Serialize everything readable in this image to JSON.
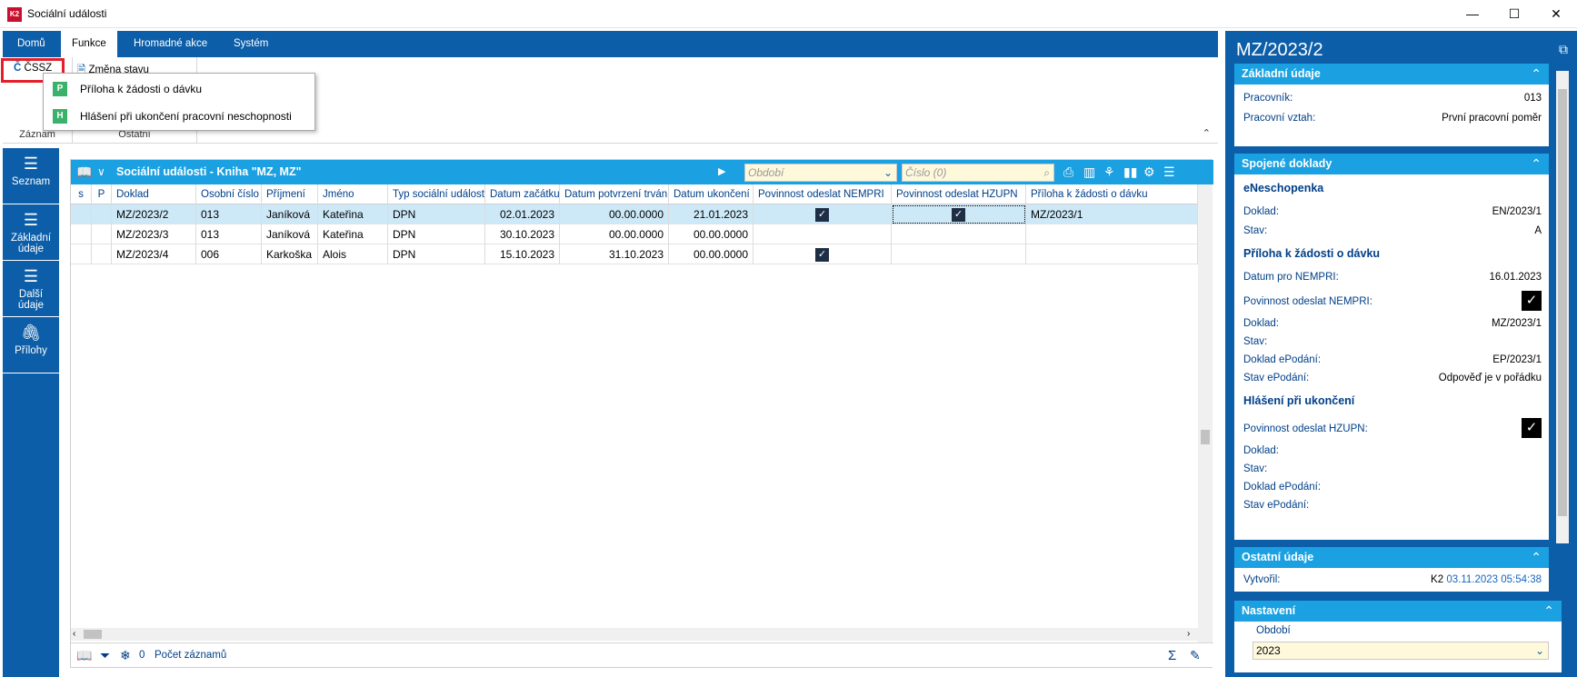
{
  "window": {
    "title": "Sociální události",
    "minimize": "—",
    "maximize": "☐",
    "close": "✕"
  },
  "ribbon": {
    "tabs": [
      "Domů",
      "Funkce",
      "Hromadné akce",
      "Systém"
    ],
    "cssz_label": "ČSSZ",
    "zmena_stavu_label": "Změna stavu",
    "group_zaznam": "Záznam",
    "group_ostatni": "Ostatní",
    "dropdown": [
      {
        "icon": "P",
        "label": "Příloha k žádosti o dávku"
      },
      {
        "icon": "H",
        "label": "Hlášení při ukončení pracovní neschopnosti"
      }
    ]
  },
  "nav": [
    {
      "label1": "Seznam",
      "label2": "",
      "icon": "list-icon"
    },
    {
      "label1": "Základní",
      "label2": "údaje",
      "icon": "list-icon"
    },
    {
      "label1": "Další",
      "label2": "údaje",
      "icon": "list-icon"
    },
    {
      "label1": "Přílohy",
      "label2": "",
      "icon": "paperclip-icon"
    }
  ],
  "grid": {
    "title": "Sociální události - Kniha \"MZ, MZ\"",
    "obdobi_placeholder": "Období",
    "cislo_placeholder": "Číslo (0)",
    "columns": [
      "s",
      "P",
      "Doklad",
      "Osobní číslo",
      "Příjmení",
      "Jméno",
      "Typ sociální události",
      "Datum začátku",
      "Datum potvrzení trvání",
      "Datum ukončení",
      "Povinnost odeslat NEMPRI",
      "Povinnost odeslat HZUPN",
      "Příloha k žádosti o dávku"
    ],
    "rows": [
      {
        "doklad": "MZ/2023/2",
        "osc": "013",
        "prijmeni": "Janíková",
        "jmeno": "Kateřina",
        "typ": "DPN",
        "zacatek": "02.01.2023",
        "potvrzeni": "00.00.0000",
        "ukonceni": "21.01.2023",
        "nempri": true,
        "hzupn": true,
        "priloha": "MZ/2023/1"
      },
      {
        "doklad": "MZ/2023/3",
        "osc": "013",
        "prijmeni": "Janíková",
        "jmeno": "Kateřina",
        "typ": "DPN",
        "zacatek": "30.10.2023",
        "potvrzeni": "00.00.0000",
        "ukonceni": "00.00.0000",
        "nempri": false,
        "hzupn": false,
        "priloha": ""
      },
      {
        "doklad": "MZ/2023/4",
        "osc": "006",
        "prijmeni": "Karkoška",
        "jmeno": "Alois",
        "typ": "DPN",
        "zacatek": "15.10.2023",
        "potvrzeni": "31.10.2023",
        "ukonceni": "00.00.0000",
        "nempri": true,
        "hzupn": false,
        "priloha": ""
      }
    ],
    "status_count": "0",
    "status_label": "Počet záznamů"
  },
  "detail": {
    "title": "MZ/2023/2",
    "zakladni": {
      "header": "Základní údaje",
      "pracovnik_k": "Pracovník:",
      "pracovnik_v": "013",
      "vztah_k": "Pracovní vztah:",
      "vztah_v": "První pracovní poměr"
    },
    "spojene": {
      "header": "Spojené doklady",
      "eneschopenka": "eNeschopenka",
      "en_doklad_k": "Doklad:",
      "en_doklad_v": "EN/2023/1",
      "en_stav_k": "Stav:",
      "en_stav_v": "A",
      "priloha": "Příloha k žádosti o dávku",
      "datum_nempri_k": "Datum pro NEMPRI:",
      "datum_nempri_v": "16.01.2023",
      "pov_nempri_k": "Povinnost odeslat NEMPRI:",
      "p_doklad_k": "Doklad:",
      "p_doklad_v": "MZ/2023/1",
      "p_stav_k": "Stav:",
      "p_epodani_k": "Doklad ePodání:",
      "p_epodani_v": "EP/2023/1",
      "p_stav_epodani_k": "Stav ePodání:",
      "p_stav_epodani_v": "Odpověď je v pořádku",
      "hlaseni": "Hlášení při ukončení",
      "pov_hzupn_k": "Povinnost odeslat HZUPN:",
      "h_doklad_k": "Doklad:",
      "h_stav_k": "Stav:",
      "h_epodani_k": "Doklad ePodání:",
      "h_stav_epodani_k": "Stav ePodání:"
    },
    "ostatni": {
      "header": "Ostatní údaje",
      "vytvoril_k": "Vytvořil:",
      "vytvoril_user": "K2",
      "vytvoril_datum": "03.11.2023 05:54:38"
    },
    "nastaveni": {
      "header": "Nastavení",
      "obdobi_label": "Období",
      "obdobi_value": "2023"
    }
  }
}
